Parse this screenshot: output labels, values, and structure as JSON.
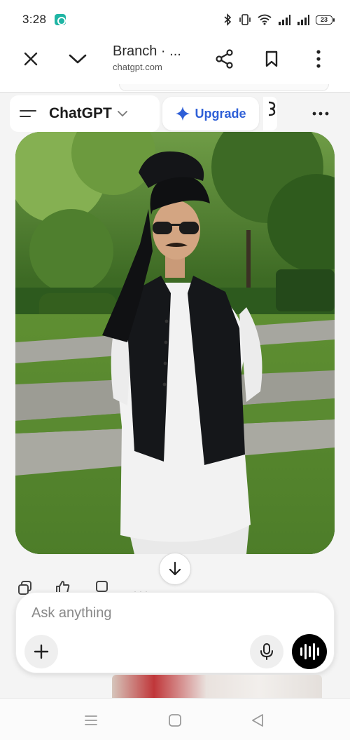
{
  "status_bar": {
    "time": "3:28",
    "battery_level": "23",
    "icons": [
      "bluetooth-icon",
      "vibrate-icon",
      "wifi-icon",
      "signal-icon",
      "signal-icon",
      "battery-icon"
    ]
  },
  "browser": {
    "title": "Branch · ...",
    "domain": "chatgpt.com",
    "buttons": [
      "close-icon",
      "chevron-down-icon",
      "share-icon",
      "bookmark-icon",
      "more-vertical-icon"
    ]
  },
  "chat_header": {
    "model_name": "ChatGPT",
    "upgrade_label": "Upgrade",
    "partial_glyph": "Ƒ",
    "colors": {
      "upgrade_text": "#2e5fd7",
      "background": "#f4f4f4"
    }
  },
  "image": {
    "subject": "man-in-black-turban-and-waistcoat-photo"
  },
  "composer": {
    "placeholder": "Ask anything",
    "buttons": [
      "plus-icon",
      "microphone-icon",
      "voice-mode-icon"
    ]
  },
  "message_actions": [
    "copy-icon",
    "thumbs-up-icon",
    "thumbs-down-icon",
    "more-horizontal-icon"
  ],
  "nav_bar": [
    "recent-apps-icon",
    "home-icon",
    "back-icon"
  ]
}
